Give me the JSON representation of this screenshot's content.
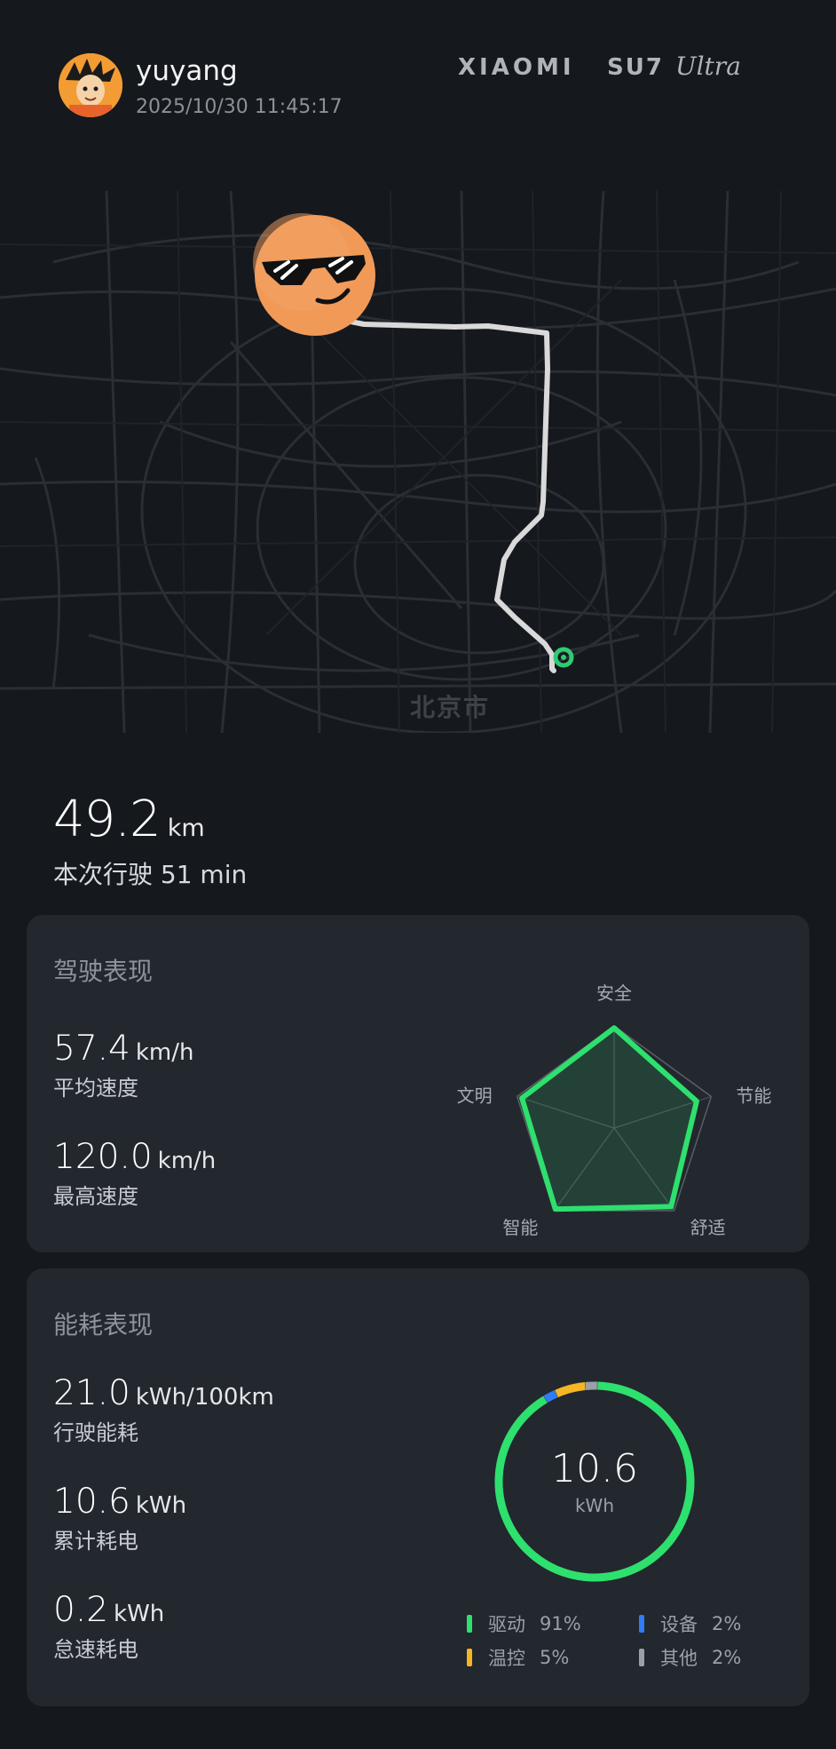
{
  "header": {
    "username": "yuyang",
    "timestamp": "2025/10/30 11:45:17",
    "brand": "XIAOMI SU7 Ultra"
  },
  "map": {
    "city_label": "北京市",
    "route_color": "#d9d9d9",
    "end_marker_color": "#2ecc71"
  },
  "trip": {
    "distance_value": "49.2",
    "distance_unit": "km",
    "summary": "本次行驶 51 min"
  },
  "driving": {
    "title": "驾驶表现",
    "avg_speed": {
      "value": "57.4",
      "unit": "km/h",
      "label": "平均速度"
    },
    "max_speed": {
      "value": "120.0",
      "unit": "km/h",
      "label": "最高速度"
    },
    "radar_axes": [
      "安全",
      "节能",
      "舒适",
      "智能",
      "文明"
    ],
    "radar_scores": [
      0.98,
      0.85,
      0.95,
      0.98,
      0.95
    ],
    "radar_color": "#2ee06e"
  },
  "energy": {
    "title": "能耗表现",
    "consumption": {
      "value": "21.0",
      "unit": "kWh/100km",
      "label": "行驶能耗"
    },
    "total": {
      "value": "10.6",
      "unit": "kWh",
      "label": "累计耗电"
    },
    "idle": {
      "value": "0.2",
      "unit": "kWh",
      "label": "怠速耗电"
    },
    "donut_value": "10.6",
    "donut_unit": "kWh",
    "breakdown": [
      {
        "name": "驱动",
        "percent_label": "91%",
        "percent": 91,
        "color": "#2ee06e"
      },
      {
        "name": "设备",
        "percent_label": "2%",
        "percent": 2,
        "color": "#2f7cf6"
      },
      {
        "name": "温控",
        "percent_label": "5%",
        "percent": 5,
        "color": "#f5b624"
      },
      {
        "name": "其他",
        "percent_label": "2%",
        "percent": 2,
        "color": "#9aa0a8"
      }
    ]
  }
}
